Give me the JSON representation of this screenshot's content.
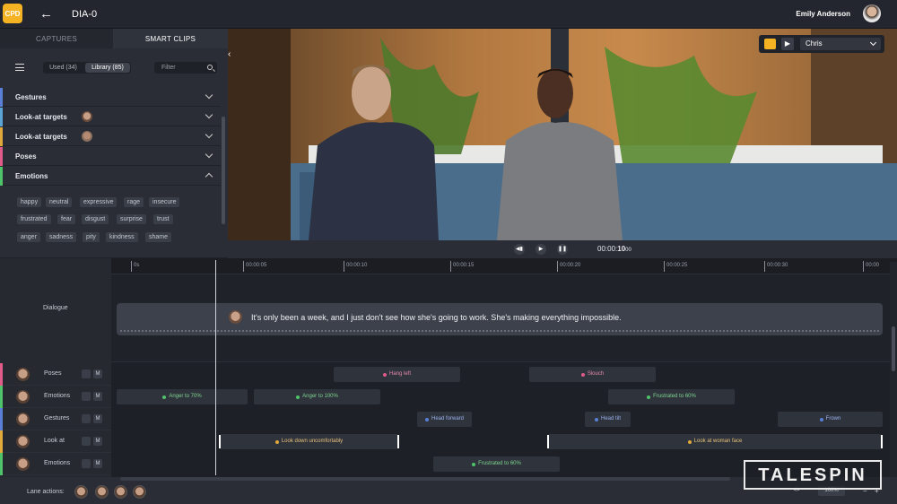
{
  "header": {
    "logo_text": "CPD",
    "back_icon": "arrow-left-icon",
    "title": "DIA-0",
    "user_name": "Emily Anderson"
  },
  "left_panel": {
    "tabs": [
      "CAPTURES",
      "SMART CLIPS"
    ],
    "active_tab": "SMART CLIPS",
    "used_label": "Used (34)",
    "library_label": "Library (85)",
    "filter_placeholder": "Filter",
    "categories": [
      {
        "label": "Gestures",
        "color": "#5a7fd6",
        "has_face": false,
        "expanded": false
      },
      {
        "label": "Look-at targets",
        "color": "#5aa5d6",
        "has_face": true,
        "expanded": false
      },
      {
        "label": "Look-at targets",
        "color": "#e0a93a",
        "has_face": true,
        "expanded": false
      },
      {
        "label": "Poses",
        "color": "#e05a8a",
        "has_face": false,
        "expanded": false
      },
      {
        "label": "Emotions",
        "color": "#4fc36a",
        "has_face": false,
        "expanded": true
      }
    ],
    "emotion_chips": [
      [
        "happy",
        "neutral",
        "expressive",
        "rage",
        "insecure"
      ],
      [
        "frustrated",
        "fear",
        "disgust",
        "surprise",
        "trust"
      ],
      [
        "anger",
        "sadness",
        "pity",
        "kindness",
        "shame"
      ]
    ]
  },
  "viewer": {
    "camera_value": "Chris",
    "timecode_main": "00:00:",
    "timecode_bold": "10",
    "timecode_frames": "00"
  },
  "ruler": {
    "ticks": [
      "0s",
      "00:00:05",
      "00:00:10",
      "00:00:15",
      "00:00:20",
      "00:00:25",
      "00:00:30",
      "00:00"
    ]
  },
  "dialogue": {
    "label": "Dialogue",
    "text": "It's only been a week, and I just don't see how she's going to work. She's making everything impossible."
  },
  "lanes": [
    {
      "label": "Poses",
      "color": "#e05a8a",
      "m": "M"
    },
    {
      "label": "Emotions",
      "color": "#4fc36a",
      "m": "M"
    },
    {
      "label": "Gestures",
      "color": "#5a7fd6",
      "m": "M"
    },
    {
      "label": "Look at",
      "color": "#e0a93a",
      "m": "M"
    },
    {
      "label": "Emotions",
      "color": "#4fc36a",
      "m": "M"
    }
  ],
  "clips": {
    "poses": [
      {
        "text": "Hang left"
      },
      {
        "text": "Slouch"
      }
    ],
    "emotions1": [
      {
        "text": "Anger to 70%"
      },
      {
        "text": "Anger to 100%"
      },
      {
        "text": "Frustrated to 60%"
      }
    ],
    "gestures": [
      {
        "text": "Head forward"
      },
      {
        "text": "Head tilt"
      },
      {
        "text": "Frown"
      }
    ],
    "lookat": [
      {
        "text": "Look down uncomfortably"
      },
      {
        "text": "Look at woman face"
      }
    ],
    "emotions2": [
      {
        "text": "Frustrated to 60%"
      }
    ]
  },
  "footer": {
    "lane_actions_label": "Lane actions:",
    "zoom_value": "100%",
    "brand": "TALESPIN"
  },
  "colors": {
    "accent": "#f5b223",
    "poses": "#e05a8a",
    "emotions": "#4fc36a",
    "gestures": "#5a7fd6",
    "lookat": "#e0a93a"
  }
}
